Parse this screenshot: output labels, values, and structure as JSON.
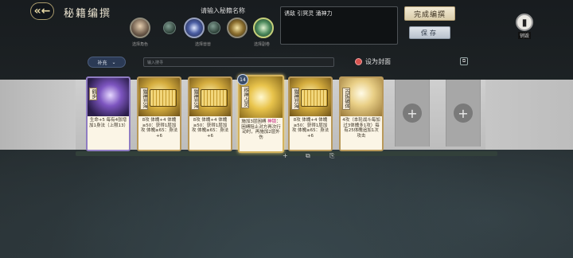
{
  "header": {
    "title": "秘籍编撰",
    "back_icon": "back-arrow-icon",
    "name_prompt": "请输入秘籍名称",
    "slot_labels": [
      "选择角色",
      "选择兽兽",
      "选择副卷"
    ],
    "tags": "诱敌 引冥灵 涌神力",
    "finish_label": "完成编撰",
    "save_label": "保存",
    "destroy_label": "销毁"
  },
  "filter": {
    "select_value": "补充",
    "search_placeholder": "输入搜寻",
    "cover_label": "设为封面"
  },
  "cards": [
    {
      "name": "鹤步",
      "desc": "生命+5 每有4张增加1身法（上限13）"
    },
    {
      "name": "猫神开海",
      "desc": "8攻 体魄+4 体魄≥50：获得1层加攻 体魄≥65：身法+6"
    },
    {
      "name": "猫神开海",
      "desc": "8攻 体魄+4 体魄≥50：获得1层加攻 体魄≥65：身法+6"
    },
    {
      "name": "移神占灵",
      "cost": "14",
      "desc_pre": "施加3层困缚",
      "desc_hl": "神锁",
      "desc_post": "：困缚阻止对方再次行动时，再施加2层外伤"
    },
    {
      "name": "猫神开海",
      "desc": "8攻 体魄+4 体魄≥50：获得1层加攻 体魄≥65：身法+6"
    },
    {
      "name": "百炼破体",
      "desc": "4攻（本轮战斗每加过3体魄多1攻）每有25体魄追加1次攻击"
    }
  ],
  "colors": {
    "accent_gold": "#b9995a",
    "highlight": "#c0187a",
    "cover_dot": "#d9534f"
  }
}
